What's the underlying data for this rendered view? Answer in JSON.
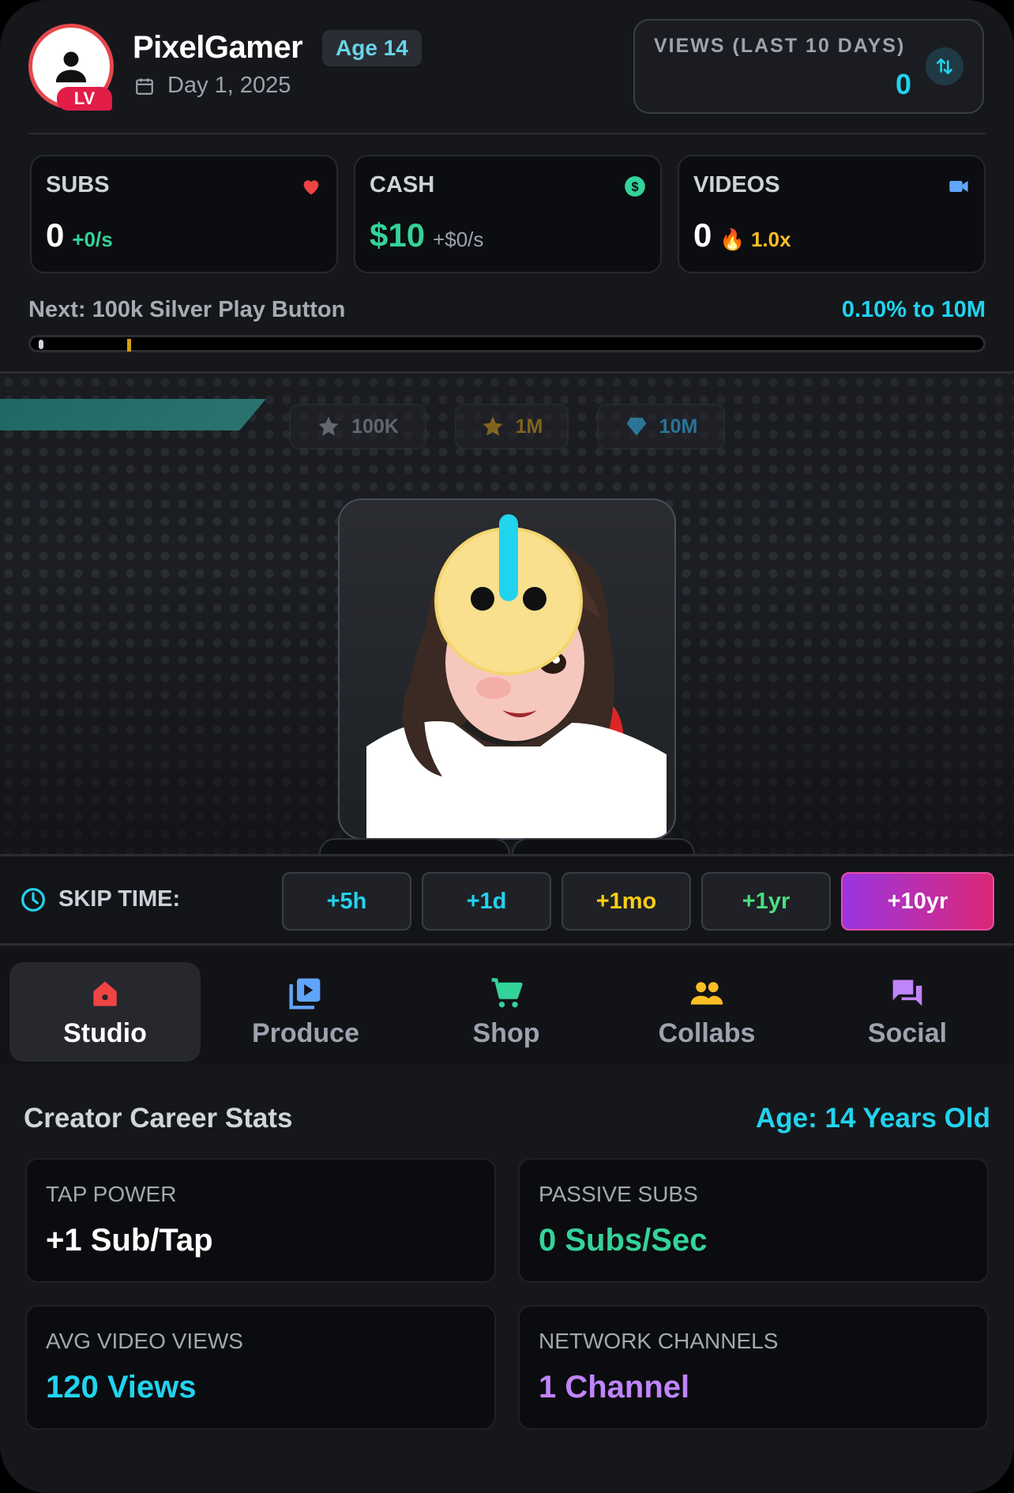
{
  "header": {
    "username": "PixelGamer",
    "age_badge": "Age 14",
    "date": "Day 1, 2025",
    "level_badge": "LV",
    "views_label": "VIEWS (LAST 10 DAYS)",
    "views_value": "0"
  },
  "stats": [
    {
      "label": "SUBS",
      "value": "0",
      "rate": "+0/s",
      "icon": "heart-icon",
      "color": "#ef4444"
    },
    {
      "label": "CASH",
      "value": "$10",
      "rate": "+$0/s",
      "icon": "dollar-icon",
      "color": "#34d399"
    },
    {
      "label": "VIDEOS",
      "value": "0",
      "rate": "🔥 1.0x",
      "icon": "video-camera-icon",
      "color": "#60a5fa"
    }
  ],
  "progress": {
    "next_label": "Next: 100k Silver Play Button",
    "percent_text": "0.10% to 10M",
    "fraction": 0.001
  },
  "milestones": [
    {
      "label": "100K",
      "icon": "star-icon",
      "color": "#9ca3af"
    },
    {
      "label": "1M",
      "icon": "star-icon",
      "color": "#d4a017"
    },
    {
      "label": "10M",
      "icon": "diamond-icon",
      "color": "#38bdf8"
    }
  ],
  "skip": {
    "label": "SKIP TIME:",
    "buttons": [
      {
        "label": "+5h",
        "color": "#22d3ee"
      },
      {
        "label": "+1d",
        "color": "#22d3ee"
      },
      {
        "label": "+1mo",
        "color": "#facc15"
      },
      {
        "label": "+1yr",
        "color": "#4ade80"
      },
      {
        "label": "+10yr",
        "color": "#ffffff"
      }
    ]
  },
  "nav": [
    {
      "label": "Studio",
      "icon": "home-icon",
      "color": "#ef4444",
      "active": true
    },
    {
      "label": "Produce",
      "icon": "video-library-icon",
      "color": "#60a5fa",
      "active": false
    },
    {
      "label": "Shop",
      "icon": "cart-icon",
      "color": "#34d399",
      "active": false
    },
    {
      "label": "Collabs",
      "icon": "group-icon",
      "color": "#fbbf24",
      "active": false
    },
    {
      "label": "Social",
      "icon": "chat-icon",
      "color": "#c084fc",
      "active": false
    }
  ],
  "career": {
    "title": "Creator Career Stats",
    "age": "Age: 14 Years Old",
    "items": [
      {
        "label": "TAP POWER",
        "value": "+1 Sub/Tap",
        "color": "#ffffff"
      },
      {
        "label": "PASSIVE SUBS",
        "value": "0 Subs/Sec",
        "color": "#34d399"
      },
      {
        "label": "AVG VIDEO VIEWS",
        "value": "120 Views",
        "color": "#22d3ee"
      },
      {
        "label": "NETWORK CHANNELS",
        "value": "1 Channel",
        "color": "#c084fc"
      }
    ]
  }
}
